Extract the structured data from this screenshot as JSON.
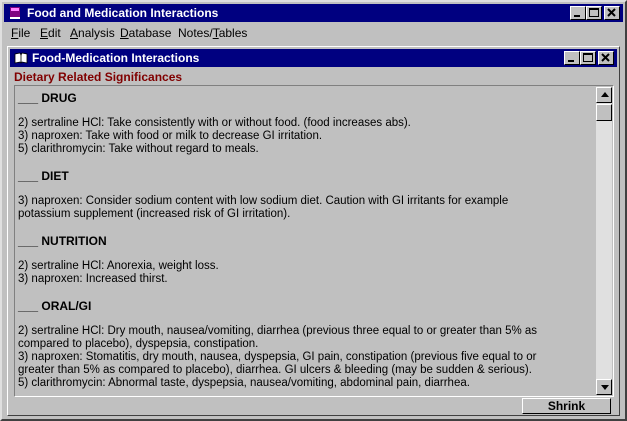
{
  "app": {
    "title": "Food and Medication Interactions",
    "menu": [
      {
        "key": "F",
        "rest": "ile"
      },
      {
        "key": "E",
        "rest": "dit"
      },
      {
        "key": "A",
        "rest": "nalysis"
      },
      {
        "key": "D",
        "rest": "atabase"
      },
      {
        "pre": "Notes/",
        "key": "T",
        "rest": "ables"
      }
    ]
  },
  "child": {
    "title": "Food-Medication Interactions",
    "heading": "Dietary Related Significances",
    "shrink_label": "Shrink"
  },
  "colors": {
    "titlebar": "#000080",
    "heading": "#800000",
    "face": "#c0c0c0"
  },
  "lines": [
    {
      "text": "___ DRUG",
      "heading": true
    },
    {
      "text": "",
      "heading": false
    },
    {
      "text": "2) sertraline HCl: Take consistently with or without food. (food increases abs).",
      "heading": false
    },
    {
      "text": "3) naproxen: Take with food or milk to decrease GI irritation.",
      "heading": false
    },
    {
      "text": "5) clarithromycin: Take without regard to meals.",
      "heading": false
    },
    {
      "text": "",
      "heading": false
    },
    {
      "text": "___ DIET",
      "heading": true
    },
    {
      "text": "",
      "heading": false
    },
    {
      "text": "3) naproxen: Consider sodium content with low sodium diet. Caution with GI irritants for example",
      "heading": false
    },
    {
      "text": "potassium supplement (increased risk of GI irritation).",
      "heading": false
    },
    {
      "text": "",
      "heading": false
    },
    {
      "text": "___ NUTRITION",
      "heading": true
    },
    {
      "text": "",
      "heading": false
    },
    {
      "text": "2) sertraline HCl: Anorexia, weight loss.",
      "heading": false
    },
    {
      "text": "3) naproxen: Increased thirst.",
      "heading": false
    },
    {
      "text": "",
      "heading": false
    },
    {
      "text": "___ ORAL/GI",
      "heading": true
    },
    {
      "text": "",
      "heading": false
    },
    {
      "text": "2) sertraline HCl: Dry mouth, nausea/vomiting, diarrhea (previous three equal to or greater than 5% as",
      "heading": false
    },
    {
      "text": "compared to placebo), dyspepsia, constipation.",
      "heading": false
    },
    {
      "text": "3) naproxen: Stomatitis, dry mouth, nausea, dyspepsia, GI pain, constipation (previous five equal to or",
      "heading": false
    },
    {
      "text": "greater than 5% as compared to placebo), diarrhea. GI ulcers & bleeding (may be sudden & serious).",
      "heading": false
    },
    {
      "text": "5) clarithromycin: Abnormal taste, dyspepsia, nausea/vomiting, abdominal pain, diarrhea.",
      "heading": false
    }
  ]
}
